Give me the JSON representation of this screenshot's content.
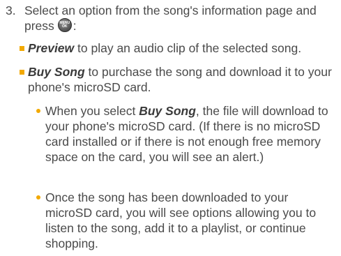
{
  "step3": {
    "number": "3.",
    "text_before_icon": "Select an option from the song's information page and press",
    "text_after_icon": ":",
    "key_icon": {
      "name": "menu-ok-key-icon",
      "line1": "MENU",
      "line2": "OK"
    }
  },
  "options": [
    {
      "emphasis": "Preview",
      "text": " to play an audio clip of the selected song."
    },
    {
      "emphasis": "Buy Song",
      "text": " to purchase the song and download it to your phone's microSD card."
    }
  ],
  "notes": [
    {
      "before": "When you select ",
      "emphasis": "Buy Song",
      "after": ", the file will download to your phone's microSD card. (If there is no microSD card installed or if there is not enough free memory space on the card, you will see an alert.)"
    },
    {
      "text": "Once the song has been downloaded to your microSD card, you will see options allowing you to listen to the song, add it to a playlist, or continue shopping."
    }
  ],
  "colors": {
    "text": "#4a4a4a",
    "bullet": "#f2a900"
  }
}
